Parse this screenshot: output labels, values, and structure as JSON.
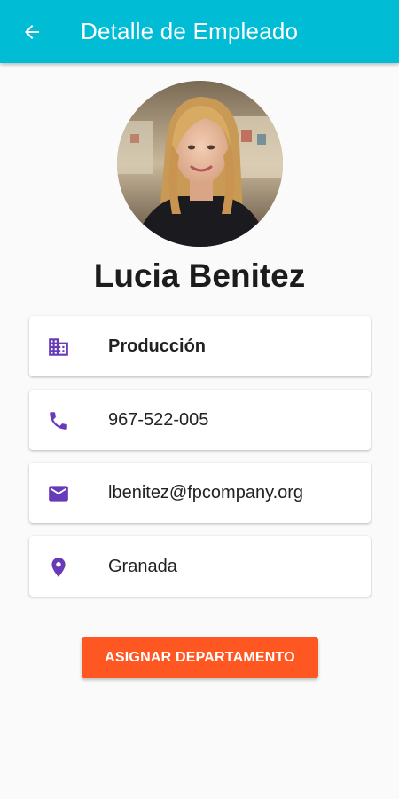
{
  "appbar": {
    "title": "Detalle de Empleado",
    "background": "#00bcd4",
    "back_icon": "arrow-back-icon"
  },
  "employee": {
    "name": "Lucia Benitez",
    "avatar": "employee-photo"
  },
  "details": [
    {
      "icon": "business-icon",
      "text": "Producción"
    },
    {
      "icon": "phone-icon",
      "text": "967-522-005"
    },
    {
      "icon": "email-icon",
      "text": "lbenitez@fpcompany.org"
    },
    {
      "icon": "location-pin-icon",
      "text": "Granada"
    }
  ],
  "actions": {
    "assign_label": "ASIGNAR DEPARTAMENTO",
    "assign_color": "#ff5722"
  },
  "colors": {
    "icon_accent": "#673ab7",
    "background": "#fafafa"
  }
}
